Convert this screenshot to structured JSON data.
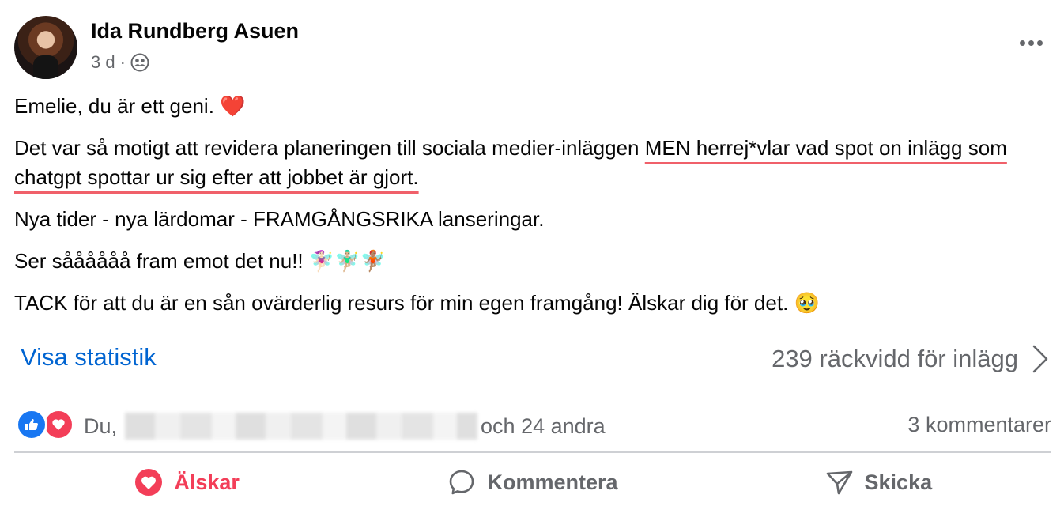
{
  "post": {
    "author": "Ida Rundberg Asuen",
    "time": "3 d",
    "separator": "·",
    "audience_icon": "friends-icon",
    "paragraphs": {
      "p1_text": "Emelie, du är ett geni.",
      "p1_emoji": "❤️",
      "p2_before": "Det var så motigt att revidera planeringen till sociala medier-inläggen ",
      "p2_underlined": "MEN herrej*vlar vad spot on inlägg som chatgpt spottar ur sig efter att jobbet är gjort.",
      "p3_text": "Nya tider - nya lärdomar - FRAMGÅNGSRIKA lanseringar.",
      "p4_text": "Ser såååååå fram emot det nu!! 🧚🏻‍♀️🧚🏼‍♂️🧚🏽",
      "p5_text": "TACK för att du är en sån ovärderlig resurs för min egen framgång! Älskar dig för det. 🥹"
    },
    "stats": {
      "link_label": "Visa statistik",
      "reach_label": "239 räckvidd för inlägg"
    },
    "reactions": {
      "types": [
        "like",
        "love"
      ],
      "prefix": "Du,",
      "suffix": "och 24 andra",
      "comments": "3 kommentarer"
    },
    "actions": {
      "love_label": "Älskar",
      "comment_label": "Kommentera",
      "send_label": "Skicka"
    },
    "colors": {
      "link": "#0064d1",
      "love": "#f33e58",
      "like": "#1877f2",
      "secondary_text": "#65676b",
      "underline": "#f0606a"
    }
  }
}
